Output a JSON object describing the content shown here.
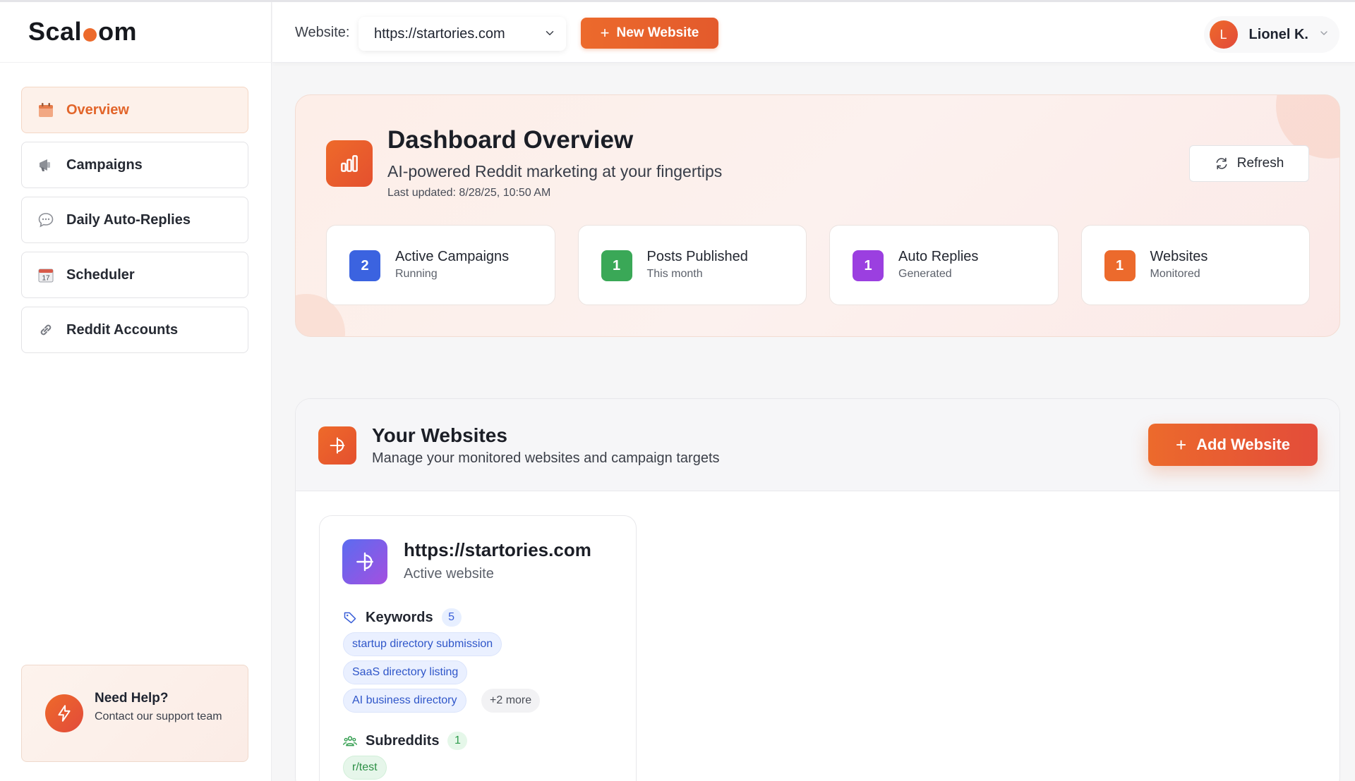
{
  "brand": {
    "logo_left": "Scal",
    "logo_right": "om"
  },
  "sidebar": {
    "items": [
      {
        "label": "Overview",
        "icon": "calendar-icon",
        "active": true
      },
      {
        "label": "Campaigns",
        "icon": "megaphone-icon",
        "active": false
      },
      {
        "label": "Daily Auto-Replies",
        "icon": "chat-bubble-icon",
        "active": false
      },
      {
        "label": "Scheduler",
        "icon": "calendar-17-icon",
        "active": false
      },
      {
        "label": "Reddit Accounts",
        "icon": "link-icon",
        "active": false
      }
    ],
    "help": {
      "title": "Need Help?",
      "subtitle": "Contact our support team"
    }
  },
  "header": {
    "website_label": "Website:",
    "website_selected": "https://startories.com",
    "new_website_label": "New Website",
    "user": {
      "initial": "L",
      "name": "Lionel K."
    }
  },
  "overview": {
    "title": "Dashboard Overview",
    "subtitle": "AI-powered Reddit marketing at your fingertips",
    "last_updated": "Last updated: 8/28/25, 10:50 AM",
    "refresh_label": "Refresh",
    "stats": [
      {
        "value": "2",
        "label": "Active Campaigns",
        "sub": "Running",
        "color": "#3b63e0"
      },
      {
        "value": "1",
        "label": "Posts Published",
        "sub": "This month",
        "color": "#3aa857"
      },
      {
        "value": "1",
        "label": "Auto Replies",
        "sub": "Generated",
        "color": "#9b3fe0"
      },
      {
        "value": "1",
        "label": "Websites",
        "sub": "Monitored",
        "color": "#ec6a2c"
      }
    ]
  },
  "websites": {
    "title": "Your Websites",
    "subtitle": "Manage your monitored websites and campaign targets",
    "add_label": "Add Website",
    "cards": [
      {
        "url": "https://startories.com",
        "status": "Active website",
        "keywords_label": "Keywords",
        "keywords_count": "5",
        "keywords": [
          "startup directory submission",
          "SaaS directory listing",
          "AI business directory"
        ],
        "more": "+2 more",
        "subreddits_label": "Subreddits",
        "subreddits_count": "1",
        "subreddits": [
          "r/test"
        ]
      }
    ]
  },
  "colors": {
    "accent": "#ec6a2c",
    "accent_bg": "#fdf1ea"
  }
}
